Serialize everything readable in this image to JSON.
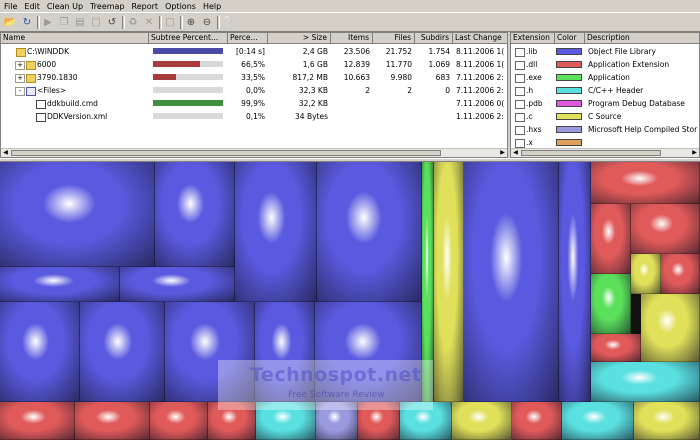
{
  "menu": [
    "File",
    "Edit",
    "Clean Up",
    "Treemap",
    "Report",
    "Options",
    "Help"
  ],
  "toolbar_icons": [
    "open-icon",
    "refresh-icon",
    "play-icon",
    "copy-icon",
    "explorer-icon",
    "command-icon",
    "refresh-branch-icon",
    "recycle-icon",
    "delete-icon",
    "new-folder-icon",
    "zoom-in-icon",
    "zoom-out-icon",
    "help-icon"
  ],
  "dir_table": {
    "headers": [
      "Name",
      "Subtree Percent...",
      "Perce...",
      "> Size",
      "Items",
      "Files",
      "Subdirs",
      "Last Change"
    ],
    "rows": [
      {
        "icon": "folder-icon",
        "expander": "",
        "name": "C:\\WINDDK",
        "bar_fraction": 1.0,
        "bar_color": "#4a4aa8",
        "percent": "[0:14 s]",
        "size": "2,4 GB",
        "items": "23.506",
        "files": "21.752",
        "subdirs": "1.754",
        "last_change": "8.11.2006  1("
      },
      {
        "icon": "folder-icon",
        "expander": "+",
        "name": "6000",
        "bar_fraction": 0.665,
        "bar_color": "#a83c3c",
        "percent": "66,5%",
        "size": "1,6 GB",
        "items": "12.839",
        "files": "11.770",
        "subdirs": "1.069",
        "last_change": "8.11.2006  1("
      },
      {
        "icon": "folder-icon",
        "expander": "+",
        "name": "3790.1830",
        "bar_fraction": 0.335,
        "bar_color": "#a83c3c",
        "percent": "33,5%",
        "size": "817,2 MB",
        "items": "10.663",
        "files": "9.980",
        "subdirs": "683",
        "last_change": "7.11.2006  2:"
      },
      {
        "icon": "files-icon",
        "expander": "-",
        "name": "<Files>",
        "bar_fraction": 0.0,
        "bar_color": "#a83c3c",
        "percent": "0,0%",
        "size": "32,3 KB",
        "items": "2",
        "files": "2",
        "subdirs": "0",
        "last_change": "7.11.2006  2:"
      },
      {
        "icon": "cmd-file-icon",
        "expander": "",
        "name": "ddkbuild.cmd",
        "bar_fraction": 0.999,
        "bar_color": "#3f8f3f",
        "percent": "99,9%",
        "size": "32,2 KB",
        "items": "",
        "files": "",
        "subdirs": "",
        "last_change": "7.11.2006  0("
      },
      {
        "icon": "xml-file-icon",
        "expander": "",
        "name": "DDKVersion.xml",
        "bar_fraction": 0.001,
        "bar_color": "#3f8f3f",
        "percent": "0,1%",
        "size": "34 Bytes",
        "items": "",
        "files": "",
        "subdirs": "",
        "last_change": "1.11.2006  2:"
      }
    ]
  },
  "ext_table": {
    "headers": [
      "Extension",
      "Color",
      "Description"
    ],
    "rows": [
      {
        "ext": ".lib",
        "color": "#5a5ae0",
        "desc": "Object File Library"
      },
      {
        "ext": ".dll",
        "color": "#e05a5a",
        "desc": "Application Extension"
      },
      {
        "ext": ".exe",
        "color": "#5ae05a",
        "desc": "Application"
      },
      {
        "ext": ".h",
        "color": "#5ae0e0",
        "desc": "C/C++ Header"
      },
      {
        "ext": ".pdb",
        "color": "#e05ae0",
        "desc": "Program Debug Database"
      },
      {
        "ext": ".c",
        "color": "#e0e05a",
        "desc": "C Source"
      },
      {
        "ext": ".hxs",
        "color": "#9a9ae0",
        "desc": "Microsoft Help Compiled Stor"
      },
      {
        "ext": ".x",
        "color": "#e0a05a",
        "desc": ""
      }
    ]
  },
  "watermark": {
    "title": "Technospot.net",
    "subtitle": "Free  Software  Review"
  }
}
